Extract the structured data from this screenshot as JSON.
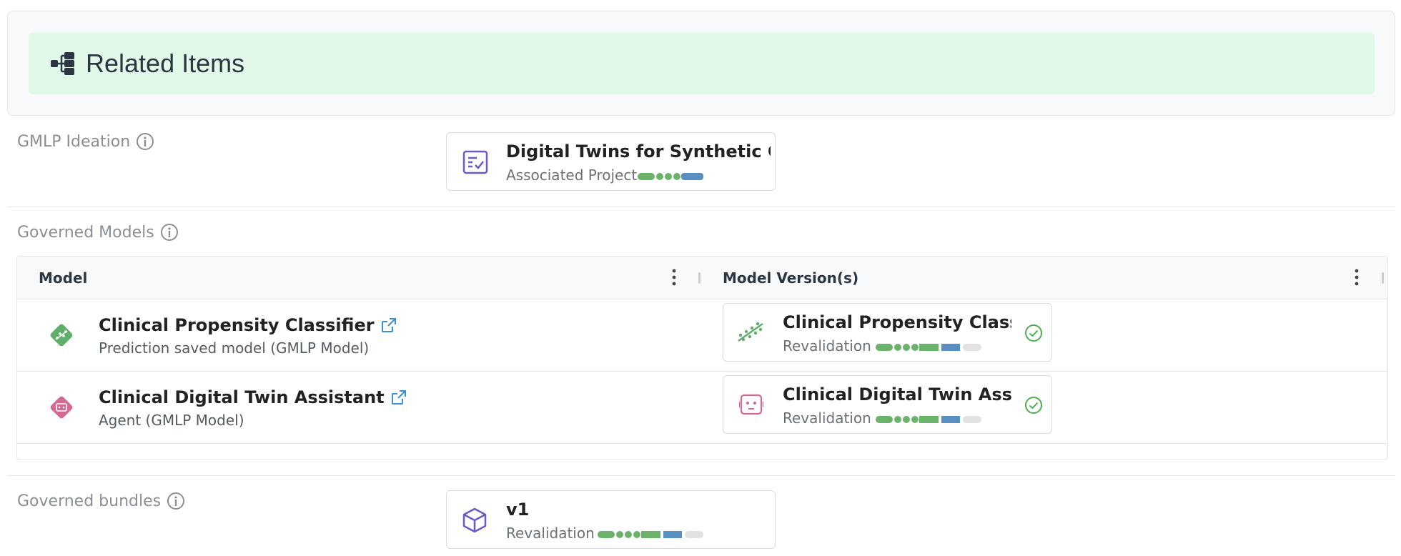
{
  "header": {
    "title": "Related Items",
    "icon": "hierarchy-icon"
  },
  "ideation": {
    "label": "GMLP Ideation",
    "card": {
      "title": "Digital Twins for Synthetic Con...",
      "subtitle": "Associated Project",
      "icon": "checklist-icon"
    }
  },
  "governed_models": {
    "label": "Governed Models",
    "columns": [
      "Model",
      "Model Version(s)"
    ],
    "rows": [
      {
        "name": "Clinical Propensity Classifier",
        "subtitle": "Prediction saved model (GMLP Model)",
        "icon": "prediction-model-icon",
        "version": {
          "title": "Clinical Propensity Classifi...",
          "subtitle": "Revalidation",
          "icon": "scatter-trend-icon"
        }
      },
      {
        "name": "Clinical Digital Twin Assistant",
        "subtitle": "Agent (GMLP Model)",
        "icon": "agent-model-icon",
        "version": {
          "title": "Clinical Digital Twin Assist...",
          "subtitle": "Revalidation",
          "icon": "robot-face-icon"
        }
      }
    ]
  },
  "governed_bundles": {
    "label": "Governed bundles",
    "card": {
      "title": "v1",
      "subtitle": "Revalidation",
      "icon": "cube-icon"
    }
  },
  "colors": {
    "green": "#6bb36b",
    "blue": "#5a8fc2",
    "gray": "#e1e2e4",
    "purple": "#6a5acd",
    "pink": "#d36a94",
    "banner": "#e2f8e9"
  }
}
